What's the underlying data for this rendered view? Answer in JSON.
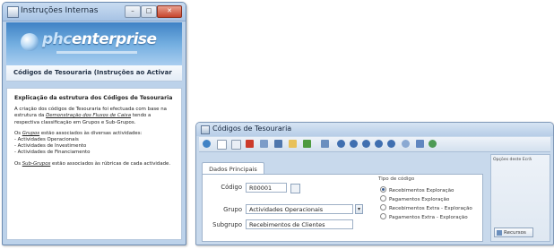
{
  "window1": {
    "title": "Instruções Internas",
    "controls": [
      "–",
      "□",
      "✕"
    ],
    "logo": {
      "lead": "phc",
      "brand": "enterprise"
    },
    "heading": "Códigos de Tesouraria (Instruções ao Activar",
    "article_title": "Explicação da estrutura dos Códigos de Tesouraria",
    "para1_a": "A criação dos códigos de Tesouraria foi efectuada com base na estrutura da ",
    "para1_em": "Demonstração dos Fluxos de Caixa",
    "para1_b": " tendo a respectiva classificação em Grupos e Sub-Grupos.",
    "para2_a": "Os ",
    "para2_em": "Grupos",
    "para2_b": " estão associados às diversas actividades:",
    "activities": [
      "- Actividades Operacionais",
      "- Actividades de Investimento",
      "- Actividades de Financiamento"
    ],
    "para3_a": "Os ",
    "para3_em": "Sub-Grupos",
    "para3_b": " estão associados às rúbricas de cada actividade."
  },
  "window2": {
    "title": "Códigos de Tesouraria",
    "tab": "Dados Principais",
    "codigo_label": "Código",
    "codigo_value": "R00001",
    "grupo_label": "Grupo",
    "grupo_value": "Actividades Operacionais",
    "subgrupo_label": "Subgrupo",
    "subgrupo_value": "Recebimentos de Clientes",
    "tipo_label": "Tipo de código",
    "tipos": [
      {
        "label": "Recebimentos Exploração",
        "selected": true
      },
      {
        "label": "Pagamentos Exploração",
        "selected": false
      },
      {
        "label": "Recebimentos Extra - Exploração",
        "selected": false
      },
      {
        "label": "Pagamentos Extra - Exploração",
        "selected": false
      }
    ],
    "side_label": "Opções deste Ecrã",
    "side_button": "Recursos"
  },
  "colors": {
    "accent": "#3f82c5",
    "window_frame": "#bcd2ea",
    "selected_radio": "#3a5d8f"
  },
  "icons": [
    "window-icon",
    "minimize-icon",
    "maximize-icon",
    "close-icon",
    "lookup-icon",
    "chevron-down-icon"
  ]
}
